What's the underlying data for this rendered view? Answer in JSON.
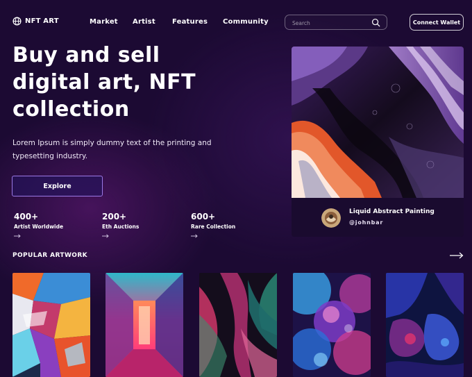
{
  "nav": {
    "logo_text": "NFT ART",
    "links": [
      "Market",
      "Artist",
      "Features",
      "Community"
    ],
    "search_placeholder": "Search",
    "connect_wallet": "Connect Wallet"
  },
  "hero": {
    "headline_line1": "Buy and sell",
    "headline_line2": "digital art, NFT",
    "headline_line3": "collection",
    "subtext_line1": "Lorem Ipsum is simply dummy text of the printing and",
    "subtext_line2": "typesetting industry.",
    "explore_label": "Explore"
  },
  "stats": [
    {
      "value": "400+",
      "label": "Artist Worldwide"
    },
    {
      "value": "200+",
      "label": "Eth Auctions"
    },
    {
      "value": "600+",
      "label": "Rare Collection"
    }
  ],
  "featured": {
    "title": "Liquid Abstract Painting",
    "author": "@johnbar"
  },
  "popular": {
    "title": "POPULAR ARTWORK"
  },
  "icons": {
    "logo": "globe-icon",
    "search": "search-icon",
    "stat_arrow": "arrow-right-icon",
    "popular_arrow": "arrow-right-icon"
  },
  "colors": {
    "background": "#1c0a33",
    "accent_border": "#9b79e6",
    "card_bg": "#1a0b2f"
  }
}
